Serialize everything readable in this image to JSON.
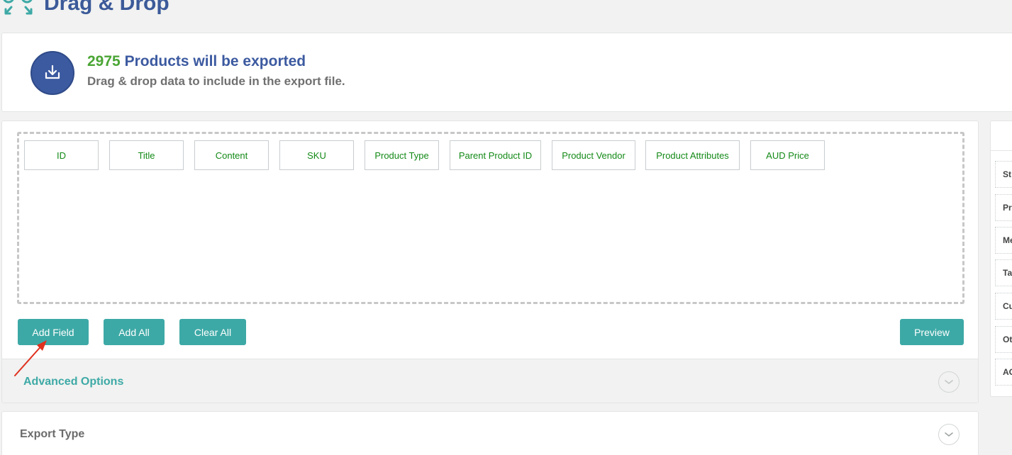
{
  "header": {
    "title": "Drag & Drop",
    "logo_icon": "drag-drop-logo-icon"
  },
  "info": {
    "icon": "download-tray-icon",
    "count": "2975",
    "headline": "Products will be exported",
    "subtitle": "Drag & drop data to include in the export file."
  },
  "fields": [
    "ID",
    "Title",
    "Content",
    "SKU",
    "Product Type",
    "Parent Product ID",
    "Product Vendor",
    "Product Attributes",
    "AUD Price"
  ],
  "actions": {
    "add_field": "Add Field",
    "add_all": "Add All",
    "clear_all": "Clear All",
    "preview": "Preview"
  },
  "advanced": {
    "label": "Advanced Options"
  },
  "export_type": {
    "label": "Export Type"
  },
  "side_panel": {
    "items": [
      "St",
      "Pr",
      "Me",
      "Ta",
      "Cu",
      "Ot",
      "AC"
    ]
  },
  "colors": {
    "accent": "#3da9a6",
    "brand_blue": "#3c5aa0",
    "count_green": "#4aa534",
    "field_text_green": "#138a17",
    "annotation_red": "#e0301e"
  }
}
